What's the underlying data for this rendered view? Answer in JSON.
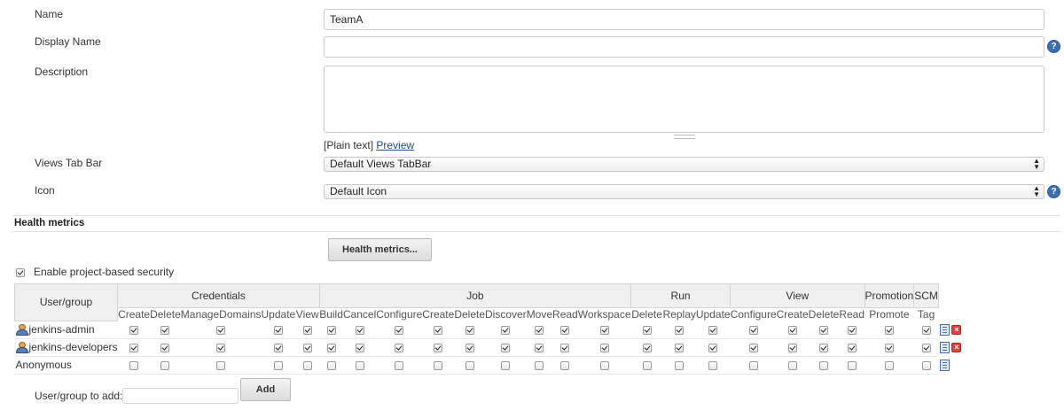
{
  "form": {
    "name": {
      "label": "Name",
      "value": "TeamA"
    },
    "display_name": {
      "label": "Display Name",
      "value": ""
    },
    "description": {
      "label": "Description",
      "value": "",
      "format_note": "[Plain text]",
      "preview_link": "Preview"
    },
    "views_tab_bar": {
      "label": "Views Tab Bar",
      "selected": "Default Views TabBar"
    },
    "icon": {
      "label": "Icon",
      "selected": "Default Icon"
    },
    "help_glyph": "?"
  },
  "health": {
    "section_title": "Health metrics",
    "button_label": "Health metrics..."
  },
  "security": {
    "enable_label": "Enable project-based security",
    "enabled": true,
    "user_group_header": "User/group",
    "groups": [
      {
        "name": "Credentials",
        "perms": [
          "Create",
          "Delete",
          "ManageDomains",
          "Update",
          "View"
        ]
      },
      {
        "name": "Job",
        "perms": [
          "Build",
          "Cancel",
          "Configure",
          "Create",
          "Delete",
          "Discover",
          "Move",
          "Read",
          "Workspace"
        ]
      },
      {
        "name": "Run",
        "perms": [
          "Delete",
          "Replay",
          "Update"
        ]
      },
      {
        "name": "View",
        "perms": [
          "Configure",
          "Create",
          "Delete",
          "Read"
        ]
      },
      {
        "name": "Promotion",
        "perms": [
          "Promote"
        ]
      },
      {
        "name": "SCM",
        "perms": [
          "Tag"
        ]
      }
    ],
    "rows": [
      {
        "name": "jenkins-admin",
        "icon": "user-icon",
        "all_checked": true,
        "removable": true
      },
      {
        "name": "jenkins-developers",
        "icon": "user-icon",
        "all_checked": true,
        "removable": true
      },
      {
        "name": "Anonymous",
        "icon": "",
        "all_checked": false,
        "removable": false
      }
    ],
    "delete_glyph": "×",
    "add_label": "User/group to add:",
    "add_value": "",
    "add_button": "Add"
  },
  "colors": {
    "help": "#3d6fb6",
    "delete": "#e04040",
    "link": "#204a87"
  }
}
